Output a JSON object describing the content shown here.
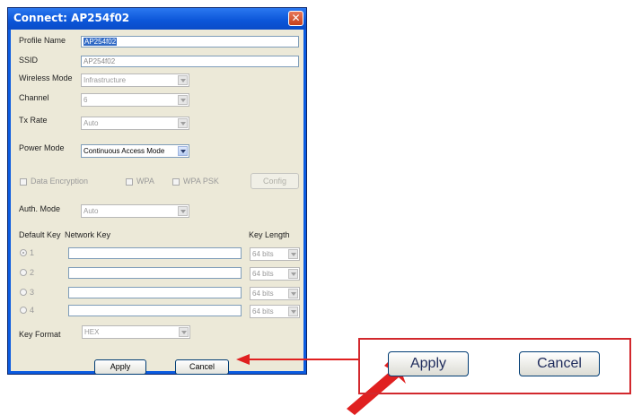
{
  "window": {
    "title": "Connect: AP254f02",
    "close_glyph": "✕"
  },
  "form": {
    "profile_name": {
      "label": "Profile Name",
      "value": "AP254f02"
    },
    "ssid": {
      "label": "SSID",
      "value": "AP254f02"
    },
    "wireless_mode": {
      "label": "Wireless Mode",
      "value": "Infrastructure"
    },
    "channel": {
      "label": "Channel",
      "value": "6"
    },
    "tx_rate": {
      "label": "Tx Rate",
      "value": "Auto"
    },
    "power_mode": {
      "label": "Power Mode",
      "value": "Continuous Access Mode"
    },
    "data_encryption": {
      "label": "Data Encryption",
      "checked": false,
      "enabled": false
    },
    "wpa": {
      "label": "WPA",
      "checked": false,
      "enabled": false
    },
    "wpa_psk": {
      "label": "WPA PSK",
      "checked": false,
      "enabled": false
    },
    "config_label": "Config",
    "auth_mode": {
      "label": "Auth. Mode",
      "value": "Auto"
    },
    "keys_header": {
      "default_key": "Default Key",
      "network_key": "Network Key",
      "key_length": "Key Length"
    },
    "keys": [
      {
        "num": "1",
        "selected": true,
        "network_key": "",
        "length": "64 bits"
      },
      {
        "num": "2",
        "selected": false,
        "network_key": "",
        "length": "64 bits"
      },
      {
        "num": "3",
        "selected": false,
        "network_key": "",
        "length": "64 bits"
      },
      {
        "num": "4",
        "selected": false,
        "network_key": "",
        "length": "64 bits"
      }
    ],
    "key_format": {
      "label": "Key Format",
      "value": "HEX"
    },
    "apply_label": "Apply",
    "cancel_label": "Cancel"
  },
  "callout": {
    "apply_label": "Apply",
    "cancel_label": "Cancel",
    "border_color": "#d2282d",
    "arrow_color": "#e02020"
  },
  "colors": {
    "title_bar": "#0b55d8",
    "dialog_face": "#ece9d8",
    "selection": "#316ac5"
  }
}
